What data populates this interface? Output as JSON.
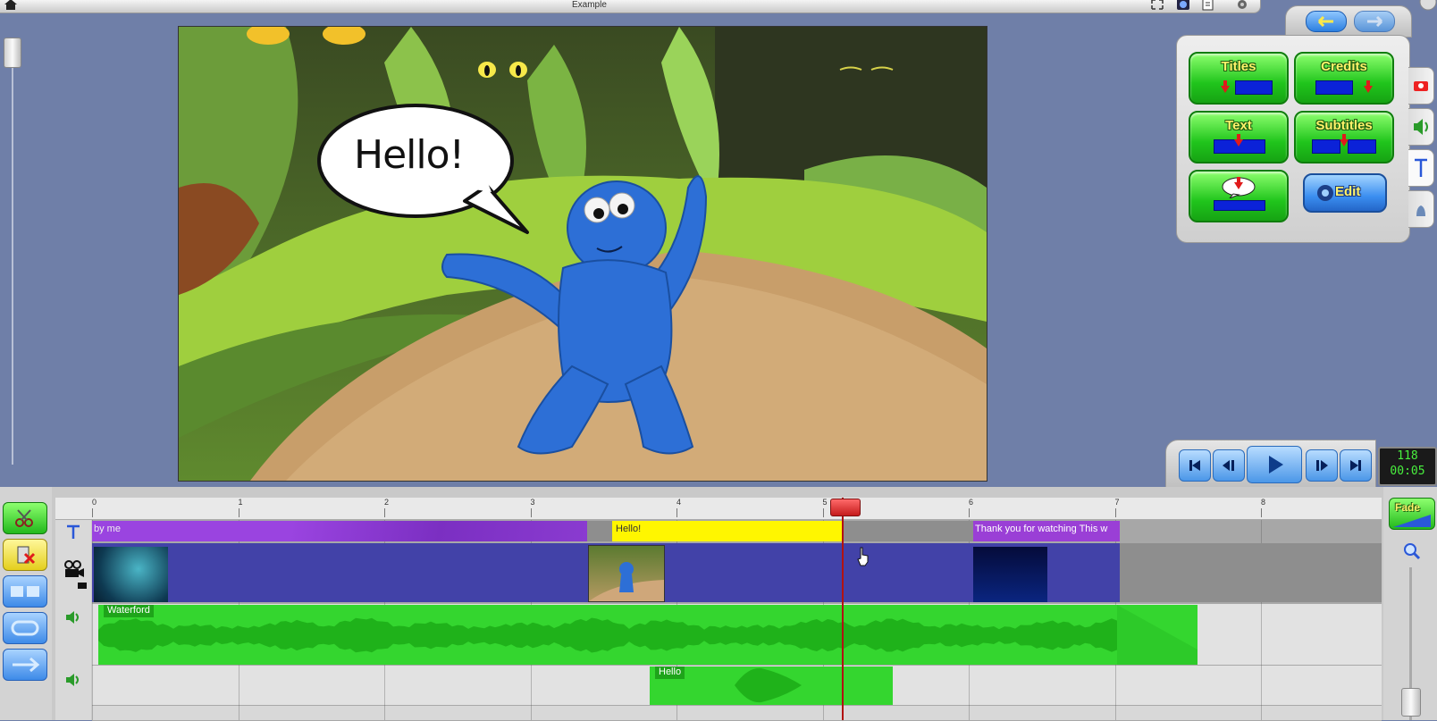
{
  "window": {
    "title": "Example"
  },
  "preview": {
    "speech_bubble": "Hello!"
  },
  "panel": {
    "titles_label": "Titles",
    "credits_label": "Credits",
    "text_label": "Text",
    "subtitles_label": "Subtitles",
    "edit_label": "Edit"
  },
  "counter": {
    "frame": "118",
    "time": "00:05"
  },
  "ruler": {
    "ticks": [
      "0",
      "1",
      "2",
      "3",
      "4",
      "5",
      "6",
      "7",
      "8"
    ]
  },
  "tracks": {
    "text_clips": [
      "by me",
      "Hello!",
      "Thank you for watching   This w"
    ],
    "audio1_label": "Waterford",
    "audio2_label": "Hello"
  },
  "right_tools": {
    "fade_label": "Fade"
  },
  "colors": {
    "title_track": "#8a3bd0",
    "video_track": "#4242a8",
    "audio_green": "#34d62f",
    "highlight_yellow": "#fff600",
    "playhead": "#b21212"
  },
  "icons": [
    "home-icon",
    "fullscreen-icon",
    "clock-icon",
    "export-icon",
    "gear-icon",
    "undo-icon",
    "redo-icon",
    "camera-icon",
    "speaker-icon",
    "text-t-icon",
    "scissors-icon",
    "delete-icon",
    "zoom-icon"
  ]
}
